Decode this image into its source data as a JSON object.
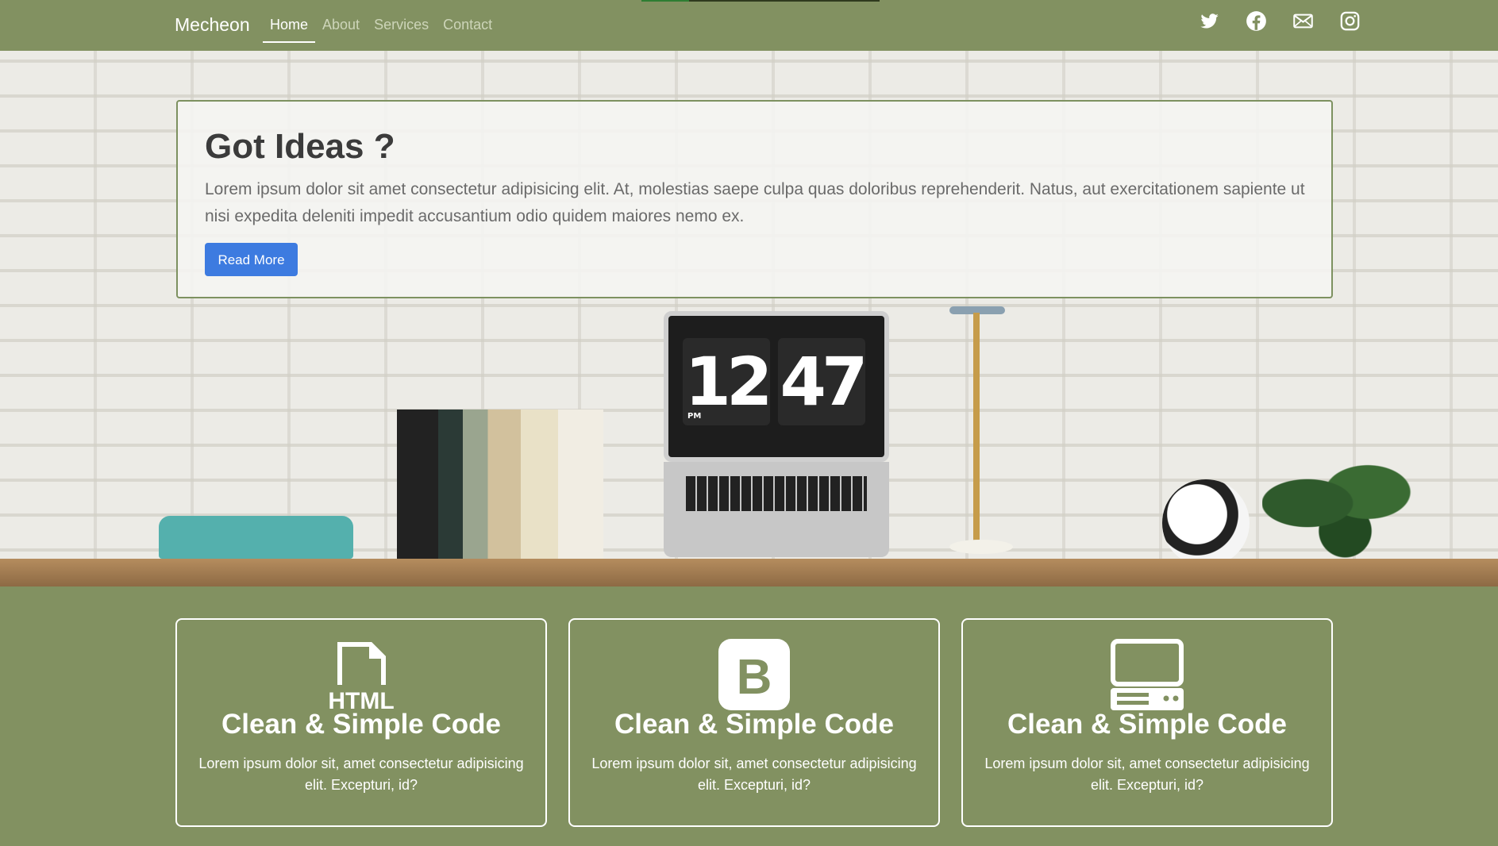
{
  "navbar": {
    "brand": "Mecheon",
    "links": [
      {
        "label": "Home",
        "active": true
      },
      {
        "label": "About",
        "active": false
      },
      {
        "label": "Services",
        "active": false
      },
      {
        "label": "Contact",
        "active": false
      }
    ],
    "social_icons": [
      "twitter-icon",
      "facebook-icon",
      "envelope-icon",
      "instagram-icon"
    ]
  },
  "hero": {
    "title": "Got Ideas ?",
    "text": "Lorem ipsum dolor sit amet consectetur adipisicing elit. At, molestias saepe culpa quas doloribus reprehenderit. Natus, aut exercitationem sapiente ut nisi expedita deleniti impedit accusantium odio quidem maiores nemo ex.",
    "button_label": "Read More",
    "clock_hour": "12",
    "clock_minute": "47",
    "clock_period": "PM"
  },
  "features": [
    {
      "icon": "html-file-icon",
      "icon_text": "HTML",
      "title": "Clean & Simple Code",
      "text": "Lorem ipsum dolor sit, amet consectetur adipisicing elit. Excepturi, id?"
    },
    {
      "icon": "bootstrap-icon",
      "icon_text": "B",
      "title": "Clean & Simple Code",
      "text": "Lorem ipsum dolor sit, amet consectetur adipisicing elit. Excepturi, id?"
    },
    {
      "icon": "computer-icon",
      "title": "Clean & Simple Code",
      "text": "Lorem ipsum dolor sit, amet consectetur adipisicing elit. Excepturi, id?"
    }
  ],
  "colors": {
    "background": "#829161",
    "accent_button": "#3d7be0",
    "card_border": "#ffffff"
  }
}
